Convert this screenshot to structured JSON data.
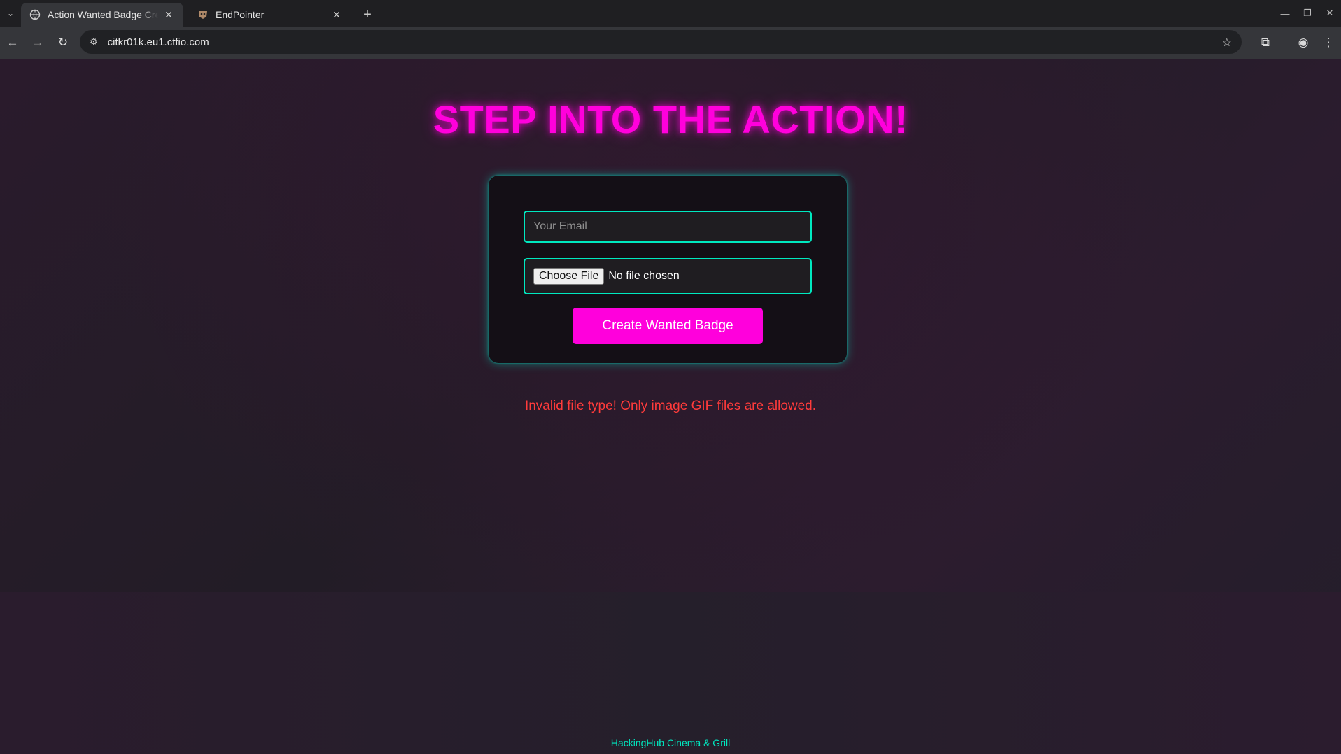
{
  "browser": {
    "tabs": [
      {
        "title": "Action Wanted Badge Creat",
        "active": true
      },
      {
        "title": "EndPointer",
        "active": false
      }
    ],
    "url": "citkr01k.eu1.ctfio.com"
  },
  "page": {
    "headline": "STEP INTO THE ACTION!",
    "form": {
      "email_placeholder": "Your Email",
      "email_value": "",
      "file_button_label": "Choose File",
      "file_status": "No file chosen",
      "submit_label": "Create Wanted Badge"
    },
    "error_message": "Invalid file type! Only image GIF files are allowed.",
    "footer": "HackingHub Cinema & Grill"
  },
  "colors": {
    "accent_magenta": "#ff00dc",
    "accent_teal": "#00e8c0",
    "error_red": "#ff3b3b"
  }
}
